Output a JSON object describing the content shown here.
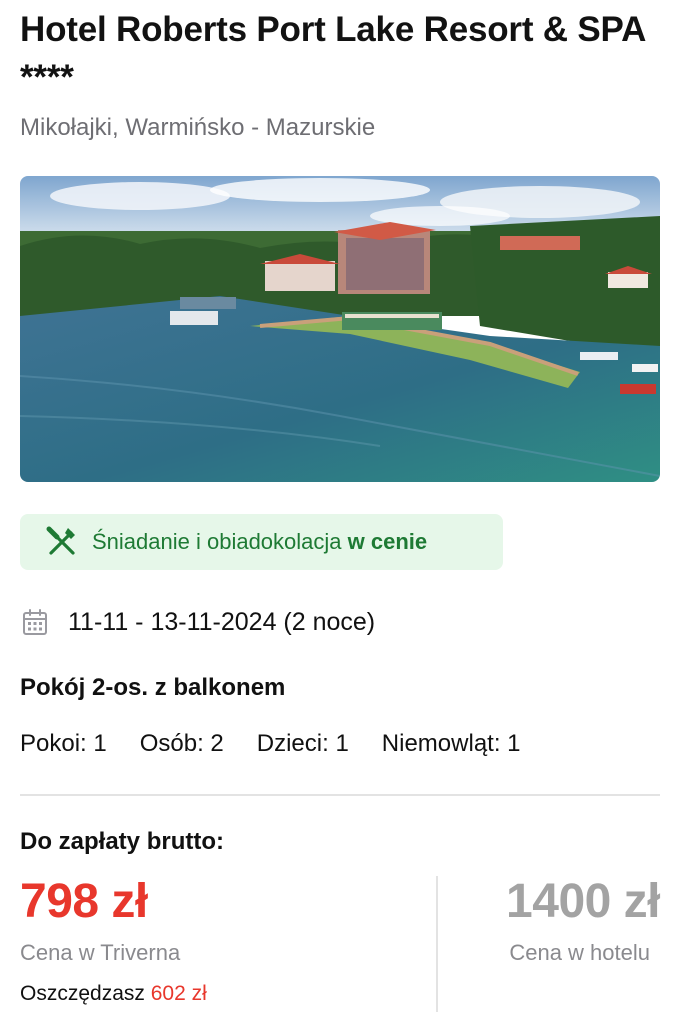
{
  "hotel": {
    "name": "Hotel Roberts Port Lake Resort & SPA ****",
    "location": "Mikołajki, Warmińsko - Mazurskie"
  },
  "photo": {
    "icon": "hotel-lake-photo"
  },
  "board": {
    "icon": "fork-knife-icon",
    "text": "Śniadanie i obiadokolacja",
    "suffix": "w cenie",
    "color": "#1e7a34",
    "background": "#e6f7e9"
  },
  "stay": {
    "icon": "calendar-icon",
    "dates": "11-11 - 13-11-2024 (2 noce)"
  },
  "room": {
    "name": "Pokój 2-os. z balkonem"
  },
  "occupancy": {
    "rooms": "Pokoi: 1",
    "persons": "Osób: 2",
    "children": "Dzieci: 1",
    "infants": "Niemowląt: 1"
  },
  "pricing": {
    "label": "Do zapłaty brutto:",
    "price": "798 zł",
    "price_label": "Cena w Triverna",
    "savings_label": "Oszczędzasz",
    "savings_amount": "602 zł",
    "hotel_price": "1400 zł",
    "hotel_price_label": "Cena w hotelu",
    "accent_color": "#e8372c"
  }
}
